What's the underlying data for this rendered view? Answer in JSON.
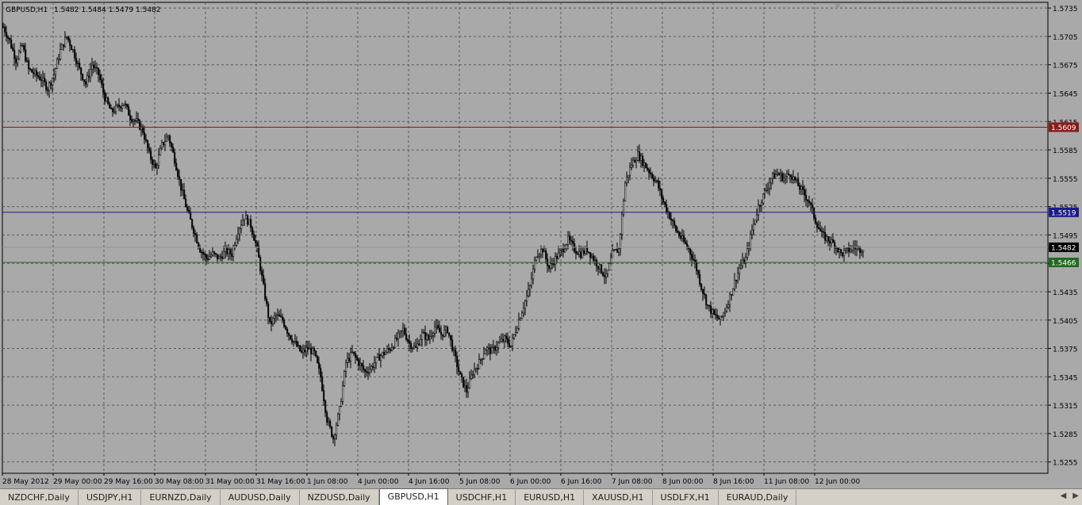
{
  "window": {
    "title": "GBPUSD,H1",
    "quote": "1.5482 1.5484 1.5479 1.5482"
  },
  "tabs": [
    {
      "label": "NZDCHF,Daily"
    },
    {
      "label": "USDJPY,H1"
    },
    {
      "label": "EURNZD,Daily"
    },
    {
      "label": "AUDUSD,Daily"
    },
    {
      "label": "NZDUSD,Daily"
    },
    {
      "label": "GBPUSD,H1",
      "active": true
    },
    {
      "label": "USDCHF,H1"
    },
    {
      "label": "EURUSD,H1"
    },
    {
      "label": "XAUUSD,H1"
    },
    {
      "label": "USDLFX,H1"
    },
    {
      "label": "EURAUD,Daily"
    }
  ],
  "colors": {
    "background": "#a9a9a9",
    "grid": "#5a5a5a",
    "candle": "#000000",
    "red_line": "#8b1a1a",
    "blue_line": "#1a1a8b",
    "green_line": "#1f6b1f",
    "bid_line": "#8a94a6"
  },
  "chart_data": {
    "type": "candlestick",
    "symbol": "GBPUSD",
    "timeframe": "H1",
    "grid": true,
    "ylim": [
      1.5243,
      1.5741
    ],
    "y_ticks": [
      "1.5735",
      "1.5705",
      "1.5675",
      "1.5645",
      "1.5615",
      "1.5585",
      "1.5555",
      "1.5525",
      "1.5495",
      "1.5465",
      "1.5435",
      "1.5405",
      "1.5375",
      "1.5345",
      "1.5315",
      "1.5285",
      "1.5255"
    ],
    "x_ticks": [
      "28 May 2012",
      "29 May 00:00",
      "29 May 16:00",
      "30 May 08:00",
      "31 May 00:00",
      "31 May 16:00",
      "1 Jun 08:00",
      "4 Jun 00:00",
      "4 Jun 16:00",
      "5 Jun 08:00",
      "6 Jun 00:00",
      "6 Jun 16:00",
      "7 Jun 08:00",
      "8 Jun 00:00",
      "8 Jun 16:00",
      "11 Jun 08:00",
      "12 Jun 00:00"
    ],
    "horizontal_lines": [
      {
        "value": 1.5609,
        "label": "1.5609",
        "color": "red"
      },
      {
        "value": 1.5519,
        "label": "1.5519",
        "color": "blue"
      },
      {
        "value": 1.5466,
        "label": "1.5466",
        "color": "green"
      },
      {
        "value": 1.5482,
        "label": "1.5482",
        "color": "bid"
      }
    ],
    "close_path": [
      [
        0,
        1.5715
      ],
      [
        4,
        1.57
      ],
      [
        8,
        1.568
      ],
      [
        12,
        1.5695
      ],
      [
        16,
        1.567
      ],
      [
        20,
        1.5665
      ],
      [
        24,
        1.566
      ],
      [
        28,
        1.565
      ],
      [
        32,
        1.5665
      ],
      [
        36,
        1.569
      ],
      [
        40,
        1.5705
      ],
      [
        44,
        1.569
      ],
      [
        48,
        1.567
      ],
      [
        52,
        1.5655
      ],
      [
        56,
        1.5675
      ],
      [
        60,
        1.5665
      ],
      [
        64,
        1.564
      ],
      [
        68,
        1.5625
      ],
      [
        72,
        1.563
      ],
      [
        76,
        1.5635
      ],
      [
        80,
        1.562
      ],
      [
        84,
        1.5615
      ],
      [
        88,
        1.5605
      ],
      [
        92,
        1.558
      ],
      [
        96,
        1.5565
      ],
      [
        100,
        1.559
      ],
      [
        104,
        1.56
      ],
      [
        108,
        1.5575
      ],
      [
        112,
        1.5545
      ],
      [
        116,
        1.552
      ],
      [
        120,
        1.55
      ],
      [
        124,
        1.548
      ],
      [
        128,
        1.547
      ],
      [
        132,
        1.5475
      ],
      [
        136,
        1.547
      ],
      [
        140,
        1.5478
      ],
      [
        144,
        1.5475
      ],
      [
        148,
        1.55
      ],
      [
        152,
        1.5515
      ],
      [
        156,
        1.5505
      ],
      [
        160,
        1.548
      ],
      [
        164,
        1.544
      ],
      [
        168,
        1.54
      ],
      [
        172,
        1.541
      ],
      [
        176,
        1.5405
      ],
      [
        180,
        1.539
      ],
      [
        184,
        1.538
      ],
      [
        188,
        1.537
      ],
      [
        192,
        1.5375
      ],
      [
        196,
        1.537
      ],
      [
        200,
        1.5345
      ],
      [
        204,
        1.53
      ],
      [
        208,
        1.528
      ],
      [
        212,
        1.531
      ],
      [
        216,
        1.536
      ],
      [
        220,
        1.537
      ],
      [
        224,
        1.536
      ],
      [
        228,
        1.535
      ],
      [
        232,
        1.5355
      ],
      [
        236,
        1.5365
      ],
      [
        240,
        1.537
      ],
      [
        244,
        1.5375
      ],
      [
        248,
        1.5385
      ],
      [
        252,
        1.5395
      ],
      [
        256,
        1.538
      ],
      [
        260,
        1.5375
      ],
      [
        264,
        1.539
      ],
      [
        268,
        1.5385
      ],
      [
        272,
        1.5398
      ],
      [
        276,
        1.539
      ],
      [
        280,
        1.5395
      ],
      [
        284,
        1.537
      ],
      [
        288,
        1.5345
      ],
      [
        292,
        1.533
      ],
      [
        296,
        1.535
      ],
      [
        300,
        1.536
      ],
      [
        304,
        1.5375
      ],
      [
        308,
        1.5372
      ],
      [
        312,
        1.538
      ],
      [
        316,
        1.5385
      ],
      [
        320,
        1.5378
      ],
      [
        324,
        1.54
      ],
      [
        328,
        1.542
      ],
      [
        332,
        1.544
      ],
      [
        336,
        1.5475
      ],
      [
        340,
        1.548
      ],
      [
        344,
        1.546
      ],
      [
        348,
        1.547
      ],
      [
        352,
        1.5478
      ],
      [
        356,
        1.549
      ],
      [
        360,
        1.548
      ],
      [
        364,
        1.5475
      ],
      [
        368,
        1.548
      ],
      [
        372,
        1.547
      ],
      [
        376,
        1.546
      ],
      [
        380,
        1.545
      ],
      [
        384,
        1.5475
      ],
      [
        388,
        1.548
      ],
      [
        392,
        1.555
      ],
      [
        396,
        1.557
      ],
      [
        400,
        1.558
      ],
      [
        404,
        1.557
      ],
      [
        408,
        1.556
      ],
      [
        412,
        1.555
      ],
      [
        416,
        1.553
      ],
      [
        420,
        1.5515
      ],
      [
        424,
        1.55
      ],
      [
        428,
        1.549
      ],
      [
        432,
        1.548
      ],
      [
        436,
        1.5465
      ],
      [
        440,
        1.544
      ],
      [
        444,
        1.542
      ],
      [
        448,
        1.541
      ],
      [
        452,
        1.5405
      ],
      [
        456,
        1.542
      ],
      [
        460,
        1.544
      ],
      [
        464,
        1.546
      ],
      [
        468,
        1.547
      ],
      [
        472,
        1.55
      ],
      [
        476,
        1.5525
      ],
      [
        480,
        1.554
      ],
      [
        484,
        1.5555
      ],
      [
        488,
        1.556
      ],
      [
        492,
        1.5555
      ],
      [
        496,
        1.556
      ],
      [
        500,
        1.555
      ],
      [
        504,
        1.554
      ],
      [
        508,
        1.553
      ],
      [
        512,
        1.551
      ],
      [
        516,
        1.5495
      ],
      [
        520,
        1.549
      ],
      [
        524,
        1.5485
      ],
      [
        528,
        1.5475
      ],
      [
        532,
        1.5478
      ],
      [
        536,
        1.5482
      ],
      [
        540,
        1.548
      ],
      [
        542,
        1.5482
      ]
    ]
  }
}
